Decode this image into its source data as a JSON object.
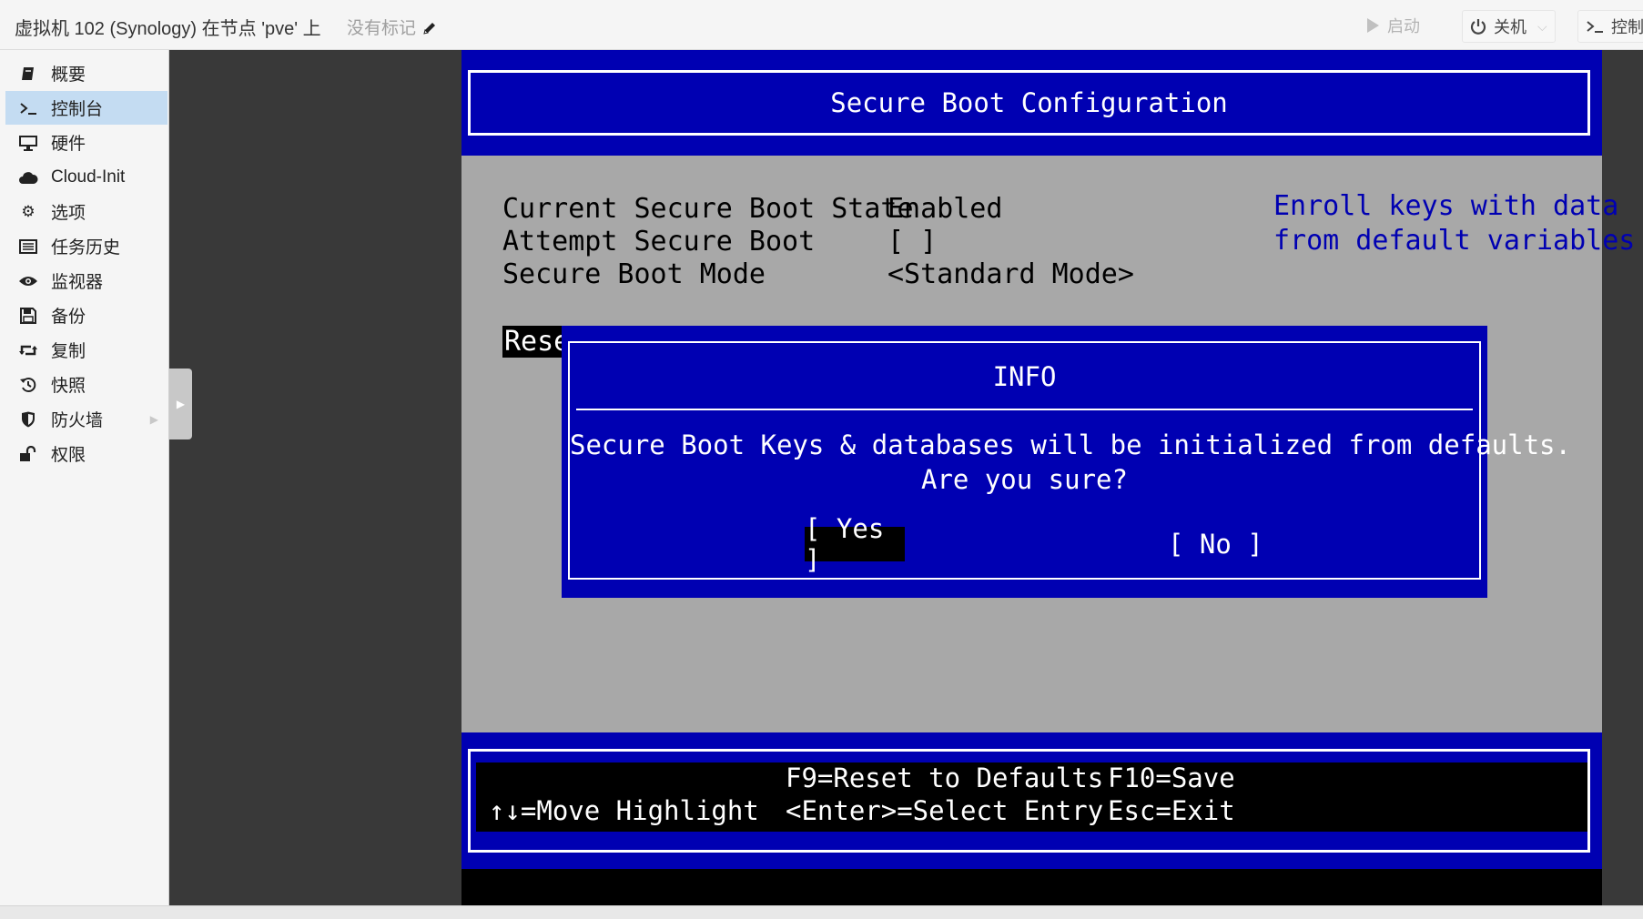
{
  "header": {
    "title": "虚拟机 102 (Synology) 在节点 'pve' 上",
    "tags": "没有标记",
    "start_label": "启动",
    "shutdown_label": "关机",
    "console_label": "控制"
  },
  "sidebar": {
    "items": [
      {
        "label": "概要",
        "icon": "book-icon"
      },
      {
        "label": "控制台",
        "icon": "terminal-icon"
      },
      {
        "label": "硬件",
        "icon": "desktop-icon"
      },
      {
        "label": "Cloud-Init",
        "icon": "cloud-icon"
      },
      {
        "label": "选项",
        "icon": "gear-icon"
      },
      {
        "label": "任务历史",
        "icon": "list-icon"
      },
      {
        "label": "监视器",
        "icon": "eye-icon"
      },
      {
        "label": "备份",
        "icon": "floppy-icon"
      },
      {
        "label": "复制",
        "icon": "retweet-icon"
      },
      {
        "label": "快照",
        "icon": "history-icon"
      },
      {
        "label": "防火墙",
        "icon": "shield-icon"
      },
      {
        "label": "权限",
        "icon": "unlock-icon"
      }
    ],
    "active_index": 1
  },
  "bios": {
    "header_title": "Secure Boot Configuration",
    "rows": [
      {
        "label": "Current Secure Boot State",
        "value": "Enabled"
      },
      {
        "label": "Attempt Secure Boot",
        "value": "[ ]"
      },
      {
        "label": "Secure Boot Mode",
        "value": "<Standard Mode>"
      }
    ],
    "highlighted_partial": "Rese",
    "help_text": "Enroll keys with data\nfrom default variables",
    "dialog": {
      "title": "INFO",
      "message_line1": "Secure Boot Keys & databases will be initialized from defaults.",
      "message_line2": "Are you sure?",
      "yes_label": "[ Yes ]",
      "no_label": "[ No ]"
    },
    "footer": {
      "move": "↑↓=Move Highlight",
      "f9": "F9=Reset to Defaults",
      "enter": "<Enter>=Select Entry",
      "f10": "F10=Save",
      "esc": "Esc=Exit"
    }
  },
  "colors": {
    "bios_blue": "#0000b2",
    "bios_gray": "#a8a8a8",
    "sidebar_active": "#c4dcf2",
    "console_bg": "#393939"
  }
}
